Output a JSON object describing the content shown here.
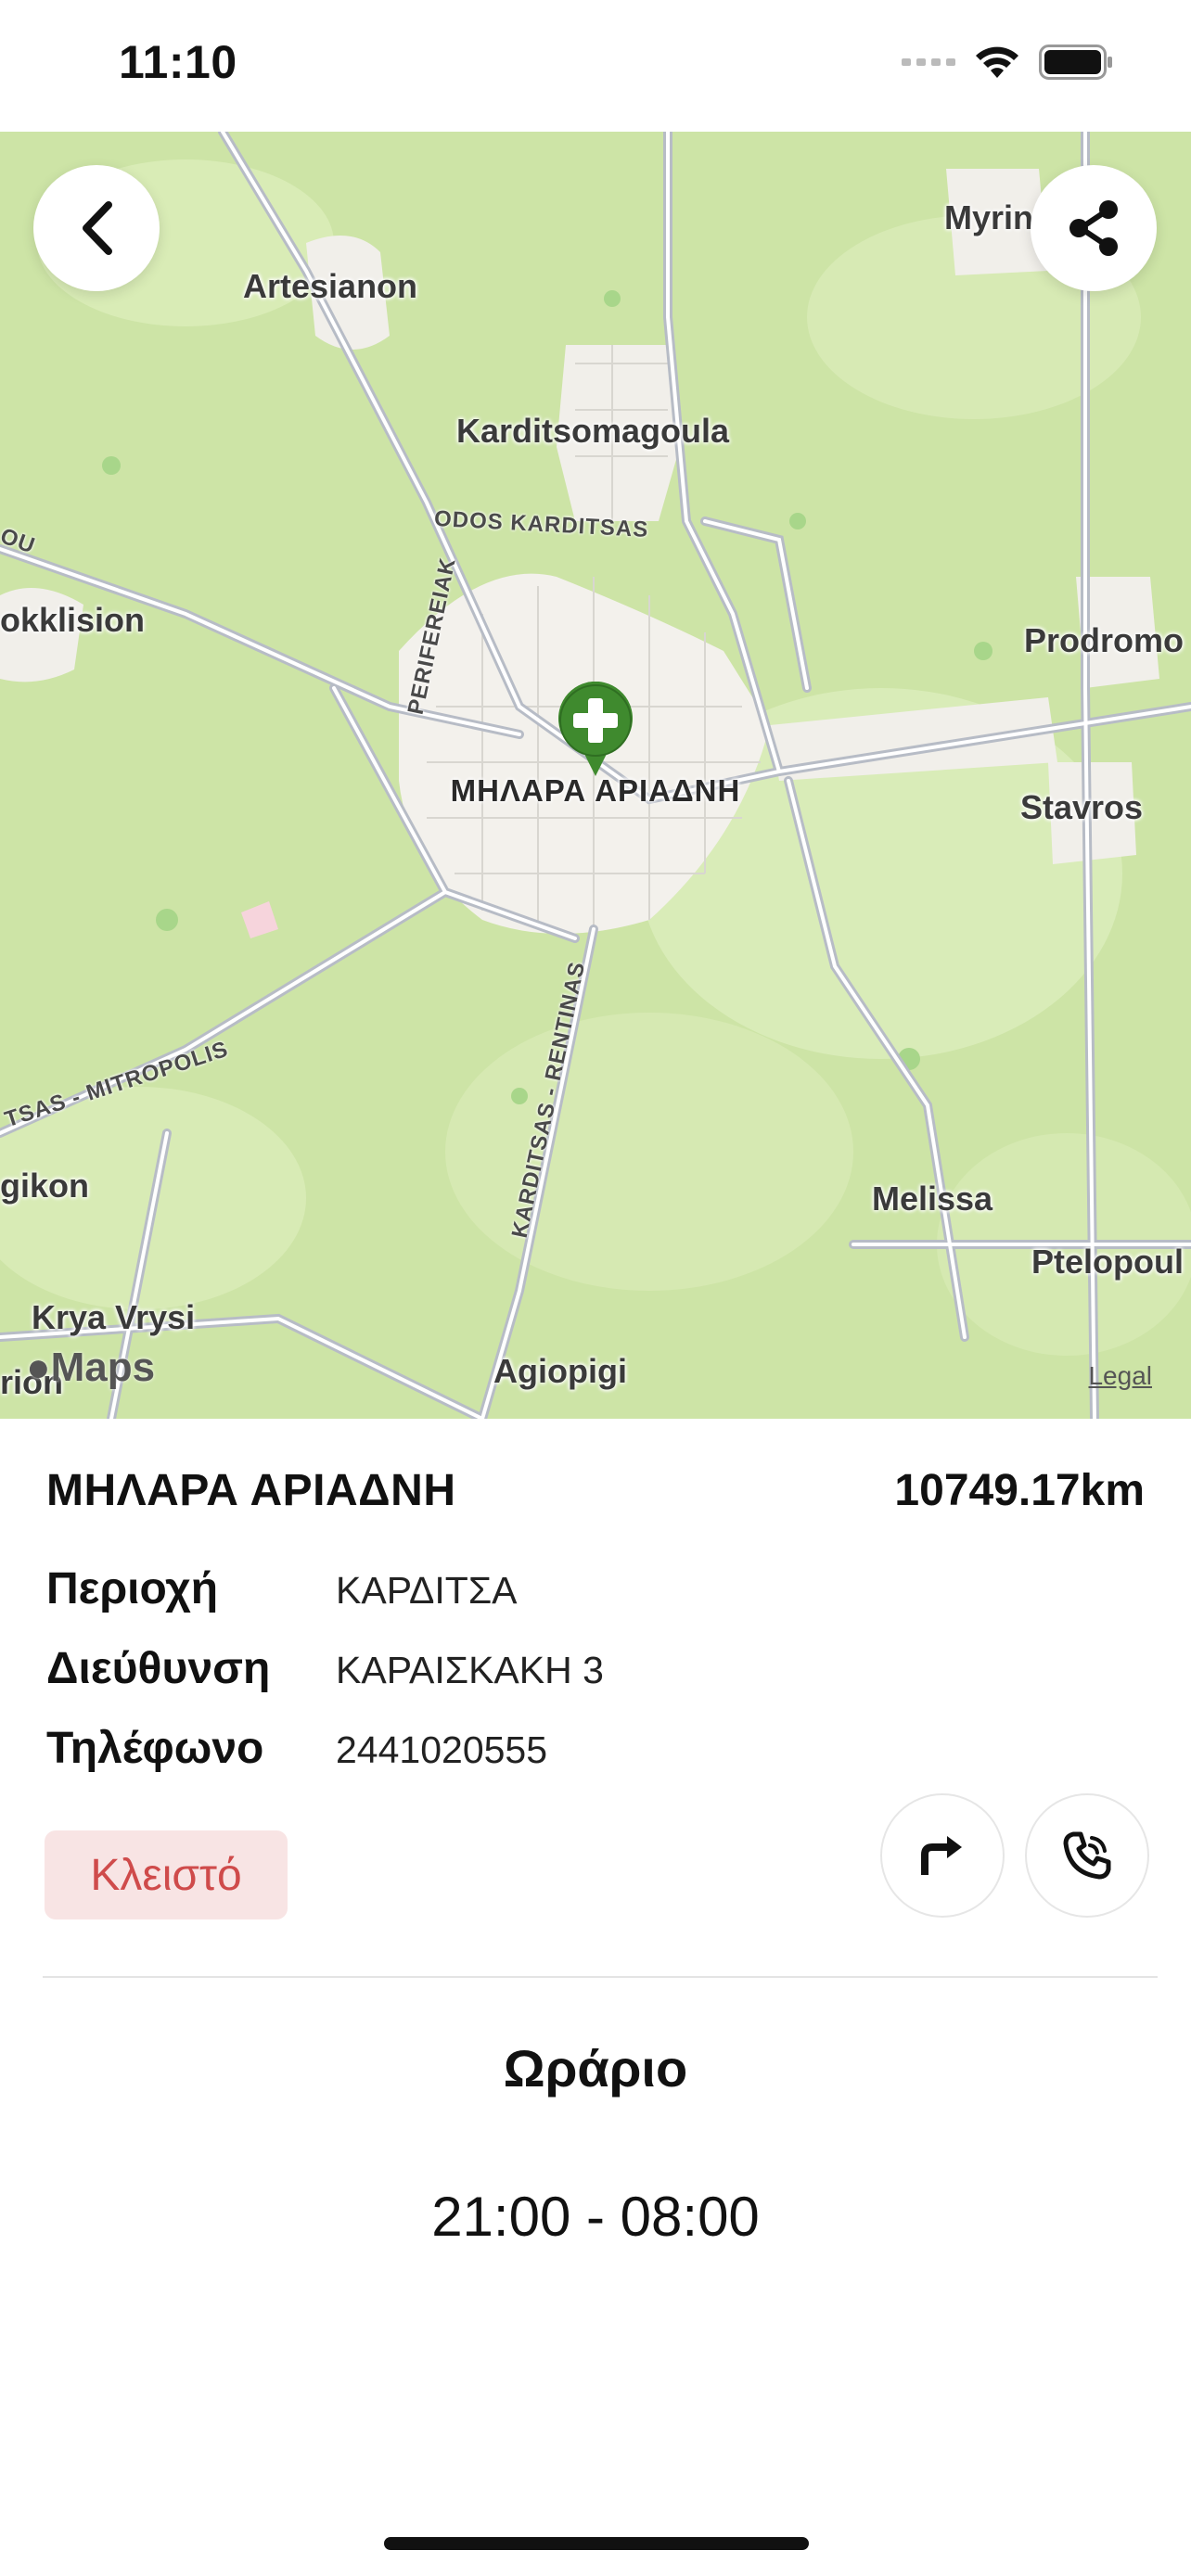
{
  "status_bar": {
    "time": "11:10"
  },
  "map": {
    "place_labels": {
      "artesianon": "Artesianon",
      "karditsomagoula": "Karditsomagoula",
      "myrina": "Myrin",
      "prodromos": "Prodromo",
      "stavros": "Stavros",
      "okklision": "okklision",
      "gikon": "gikon",
      "melissa": "Melissa",
      "ptelopoula": "Ptelopoul",
      "krya_vrysi": "Krya Vrysi",
      "agiopigi": "Agiopigi",
      "rion": "rion"
    },
    "road_labels": {
      "odos_karditsas": "ODOS KARDITSAS",
      "perifereiak": "PERIFEREIAK",
      "karditsas_mitropolis": "TSAS - MITROPOLIS",
      "karditsas_rentinas": "KARDITSAS - RENTINAS",
      "left_edge": "OU"
    },
    "pin_label": "ΜΗΛΑΡΑ ΑΡΙΑΔΝΗ",
    "maps_logo": "Maps",
    "legal": "Legal",
    "pin_color": "#3f8a2e",
    "back_icon": "chevron-left-icon",
    "share_icon": "share-icon"
  },
  "pharmacy": {
    "name": "ΜΗΛΑΡΑ ΑΡΙΑΔΝΗ",
    "distance": "10749.17km",
    "area_label": "Περιοχή",
    "area_value": "ΚΑΡΔΙΤΣΑ",
    "address_label": "Διεύθυνση",
    "address_value": "ΚΑΡΑΙΣΚΑΚΗ 3",
    "phone_label": "Τηλέφωνο",
    "phone_value": "2441020555",
    "status": "Κλειστό",
    "status_color": "#cf4b4b",
    "directions_icon": "directions-arrow-icon",
    "call_icon": "phone-icon"
  },
  "hours": {
    "title": "Ωράριο",
    "value": "21:00 - 08:00"
  }
}
